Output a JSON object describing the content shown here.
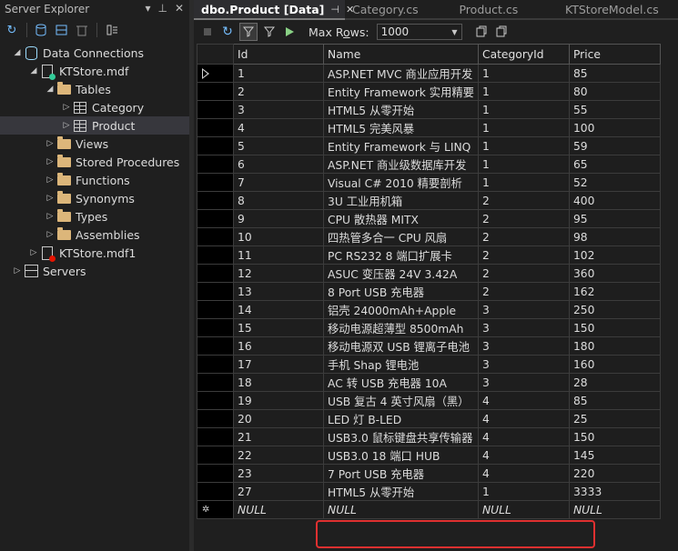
{
  "server_explorer": {
    "title": "Server Explorer",
    "controls": [
      "▾",
      "⊥",
      "✕"
    ],
    "toolbar_icons": [
      "refresh-icon",
      "connect-database-icon",
      "connect-server-icon",
      "delete-icon",
      "properties-icon"
    ],
    "tree": [
      {
        "label": "Data Connections",
        "level": 0,
        "expanded": true,
        "icon": "data-connections-icon"
      },
      {
        "label": "KTStore.mdf",
        "level": 1,
        "expanded": true,
        "icon": "database-file-icon"
      },
      {
        "label": "Tables",
        "level": 2,
        "expanded": true,
        "icon": "folder-icon"
      },
      {
        "label": "Category",
        "level": 3,
        "expanded": false,
        "icon": "table-icon"
      },
      {
        "label": "Product",
        "level": 3,
        "expanded": false,
        "icon": "table-icon",
        "selected": true
      },
      {
        "label": "Views",
        "level": 2,
        "expanded": false,
        "icon": "folder-icon"
      },
      {
        "label": "Stored Procedures",
        "level": 2,
        "expanded": false,
        "icon": "folder-icon"
      },
      {
        "label": "Functions",
        "level": 2,
        "expanded": false,
        "icon": "folder-icon"
      },
      {
        "label": "Synonyms",
        "level": 2,
        "expanded": false,
        "icon": "folder-icon"
      },
      {
        "label": "Types",
        "level": 2,
        "expanded": false,
        "icon": "folder-icon"
      },
      {
        "label": "Assemblies",
        "level": 2,
        "expanded": false,
        "icon": "folder-icon"
      },
      {
        "label": "KTStore.mdf1",
        "level": 1,
        "expanded": false,
        "icon": "database-file-error-icon"
      },
      {
        "label": "Servers",
        "level": 0,
        "expanded": false,
        "icon": "servers-icon"
      }
    ]
  },
  "tabs": [
    {
      "label": "dbo.Product [Data]",
      "active": true,
      "pin": "⊣",
      "close": "✕"
    },
    {
      "label": "Category.cs",
      "active": false
    },
    {
      "label": "Product.cs",
      "active": false
    },
    {
      "label": "KTStoreModel.cs",
      "active": false
    }
  ],
  "data_toolbar": {
    "max_rows_label_pre": "Max R",
    "max_rows_label_u": "o",
    "max_rows_label_post": "ws:",
    "max_rows_value": "1000"
  },
  "grid": {
    "columns": [
      "Id",
      "Name",
      "CategoryId",
      "Price"
    ],
    "rows": [
      [
        "1",
        "ASP.NET MVC 商业应用开发",
        "1",
        "85"
      ],
      [
        "2",
        "Entity Framework 实用精要",
        "1",
        "80"
      ],
      [
        "3",
        "HTML5 从零开始",
        "1",
        "55"
      ],
      [
        "4",
        "HTML5 完美风暴",
        "1",
        "100"
      ],
      [
        "5",
        "Entity Framework 与 LINQ",
        "1",
        "59"
      ],
      [
        "6",
        "ASP.NET 商业级数据库开发",
        "1",
        "65"
      ],
      [
        "7",
        "Visual C# 2010 精要剖析",
        "1",
        "52"
      ],
      [
        "8",
        "3U 工业用机箱",
        "2",
        "400"
      ],
      [
        "9",
        "CPU 散热器 MITX",
        "2",
        "95"
      ],
      [
        "10",
        "四热管多合一 CPU 风扇",
        "2",
        "98"
      ],
      [
        "11",
        "PC RS232 8 端口扩展卡",
        "2",
        "102"
      ],
      [
        "12",
        "ASUC 变压器 24V 3.42A",
        "2",
        "360"
      ],
      [
        "13",
        "8 Port USB 充电器",
        "2",
        "162"
      ],
      [
        "14",
        "铝壳 24000mAh+Apple",
        "3",
        "250"
      ],
      [
        "15",
        "移动电源超薄型 8500mAh",
        "3",
        "150"
      ],
      [
        "16",
        "移动电源双 USB 锂离子电池",
        "3",
        "180"
      ],
      [
        "17",
        "手机 Shap 锂电池",
        "3",
        "160"
      ],
      [
        "18",
        "AC 转 USB 充电器 10A",
        "3",
        "28"
      ],
      [
        "19",
        "USB 复古 4 英寸风扇（黑）",
        "4",
        "85"
      ],
      [
        "20",
        "LED 灯 B-LED",
        "4",
        "25"
      ],
      [
        "21",
        "USB3.0 鼠标键盘共享传输器",
        "4",
        "150"
      ],
      [
        "22",
        "USB3.0 18 端口 HUB",
        "4",
        "145"
      ],
      [
        "23",
        "7 Port USB 充电器",
        "4",
        "220"
      ],
      [
        "27",
        "HTML5 从零开始",
        "1",
        "3333"
      ]
    ],
    "new_row": [
      "NULL",
      "NULL",
      "NULL",
      "NULL"
    ]
  },
  "colors": {
    "highlight": "#e03030",
    "folder": "#dcb67a",
    "accent": "#75beff"
  }
}
